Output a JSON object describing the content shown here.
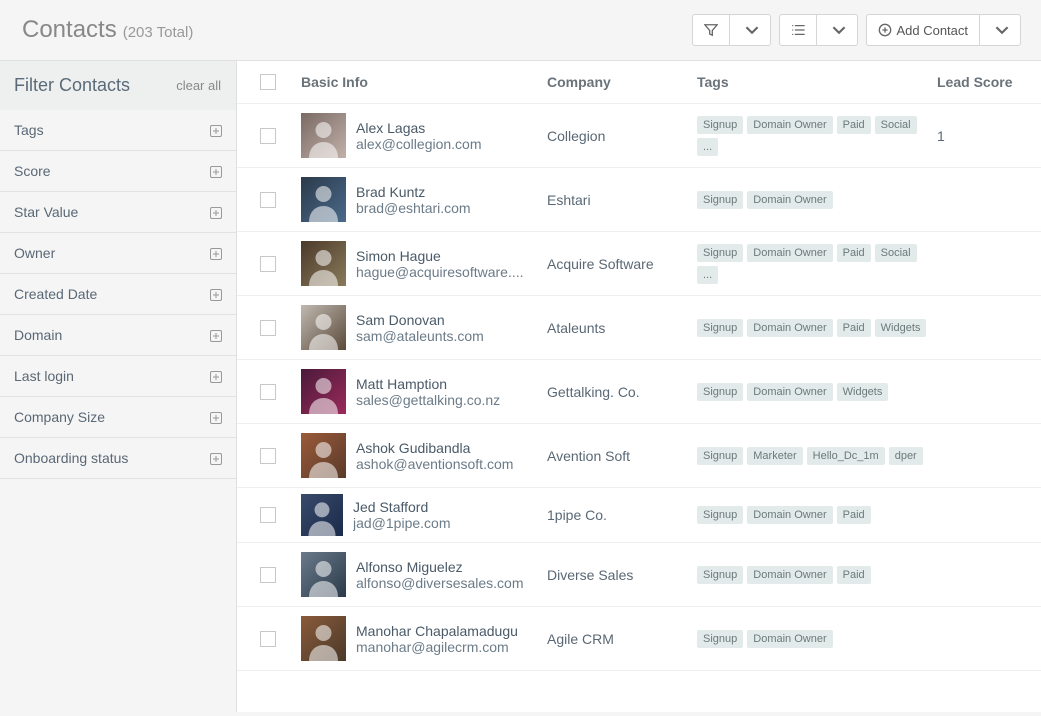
{
  "header": {
    "title": "Contacts",
    "subtitle": "(203 Total)",
    "add_contact": "Add Contact"
  },
  "sidebar": {
    "title": "Filter Contacts",
    "clear_all": "clear all",
    "filters": [
      {
        "label": "Tags"
      },
      {
        "label": "Score"
      },
      {
        "label": "Star Value"
      },
      {
        "label": "Owner"
      },
      {
        "label": "Created Date"
      },
      {
        "label": "Domain"
      },
      {
        "label": "Last login"
      },
      {
        "label": "Company Size"
      },
      {
        "label": "Onboarding status"
      }
    ]
  },
  "columns": {
    "basic": "Basic Info",
    "company": "Company",
    "tags": "Tags",
    "lead": "Lead Score"
  },
  "avatar_colors": [
    [
      "#7a6a64",
      "#c0b0a8"
    ],
    [
      "#2b3a4a",
      "#4a6a8a"
    ],
    [
      "#4a3a2a",
      "#8a7a5a"
    ],
    [
      "#c0b8b0",
      "#5a4a3a"
    ],
    [
      "#4a1a3a",
      "#9a2a5a"
    ],
    [
      "#9a5a3a",
      "#5a3a2a"
    ],
    [
      "#3a4a6a",
      "#1a2a4a"
    ],
    [
      "#6a7a8a",
      "#2a3a4a"
    ],
    [
      "#8a5a3a",
      "#4a3a2a"
    ]
  ],
  "contacts": [
    {
      "name": "Alex Lagas",
      "email": "alex@collegion.com",
      "company": "Collegion",
      "tags": [
        "Signup",
        "Domain Owner",
        "Paid",
        "Social"
      ],
      "more": true,
      "lead": "1"
    },
    {
      "name": "Brad Kuntz",
      "email": "brad@eshtari.com",
      "company": "Eshtari",
      "tags": [
        "Signup",
        "Domain Owner"
      ],
      "more": false,
      "lead": ""
    },
    {
      "name": "Simon Hague",
      "email": "hague@acquiresoftware....",
      "company": "Acquire Software",
      "tags": [
        "Signup",
        "Domain Owner",
        "Paid",
        "Social"
      ],
      "more": true,
      "lead": ""
    },
    {
      "name": "Sam Donovan",
      "email": "sam@ataleunts.com",
      "company": "Ataleunts",
      "tags": [
        "Signup",
        "Domain Owner",
        "Paid",
        "Widgets"
      ],
      "more": false,
      "lead": ""
    },
    {
      "name": "Matt Hamption",
      "email": "sales@gettalking.co.nz",
      "company": "Gettalking. Co.",
      "tags": [
        "Signup",
        "Domain Owner",
        "Widgets"
      ],
      "more": false,
      "lead": ""
    },
    {
      "name": "Ashok Gudibandla",
      "email": "ashok@aventionsoft.com",
      "company": "Avention Soft",
      "tags": [
        "Signup",
        "Marketer",
        "Hello_Dc_1m",
        "dper"
      ],
      "more": false,
      "lead": ""
    },
    {
      "name": "Jed Stafford",
      "email": "jad@1pipe.com",
      "company": "1pipe Co.",
      "tags": [
        "Signup",
        "Domain Owner",
        "Paid"
      ],
      "more": false,
      "lead": ""
    },
    {
      "name": "Alfonso Miguelez",
      "email": "alfonso@diversesales.com",
      "company": "Diverse Sales",
      "tags": [
        "Signup",
        "Domain Owner",
        "Paid"
      ],
      "more": false,
      "lead": ""
    },
    {
      "name": "Manohar Chapalamadugu",
      "email": "manohar@agilecrm.com",
      "company": "Agile CRM",
      "tags": [
        "Signup",
        "Domain Owner"
      ],
      "more": false,
      "lead": ""
    }
  ]
}
